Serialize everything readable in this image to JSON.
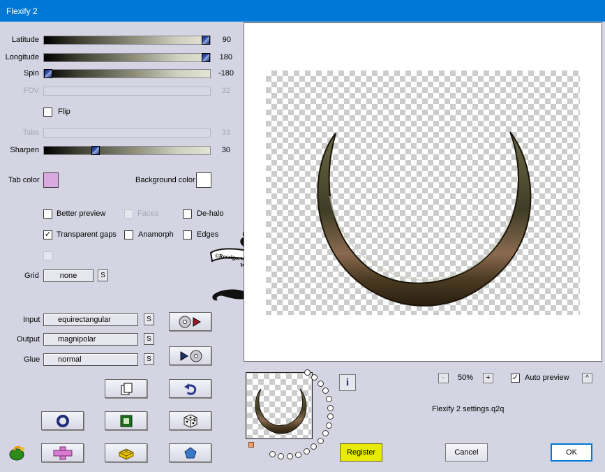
{
  "window": {
    "title": "Flexify 2"
  },
  "sliders": {
    "latitude": {
      "label": "Latitude",
      "value": "90",
      "fraction": 1.0,
      "enabled": true
    },
    "longitude": {
      "label": "Longitude",
      "value": "180",
      "fraction": 1.0,
      "enabled": true
    },
    "spin": {
      "label": "Spin",
      "value": "-180",
      "fraction": 0.0,
      "enabled": true
    },
    "fov": {
      "label": "FOV",
      "value": "32",
      "fraction": 0.2,
      "enabled": false
    },
    "tabs": {
      "label": "Tabs",
      "value": "33",
      "fraction": 0.33,
      "enabled": false
    },
    "sharpen": {
      "label": "Sharpen",
      "value": "30",
      "fraction": 0.3,
      "enabled": true
    }
  },
  "flip": {
    "label": "Flip",
    "checked": false
  },
  "colors": {
    "tab_label": "Tab color",
    "tab_color": "#d9a9df",
    "background_label": "Background color",
    "background_color": "#ffffff"
  },
  "options": {
    "better_preview": {
      "label": "Better preview",
      "checked": false
    },
    "faces": {
      "label": "Faces",
      "checked": false,
      "enabled": false
    },
    "de_halo": {
      "label": "De-halo",
      "checked": false
    },
    "transparent_gaps": {
      "label": "Transparent gaps",
      "checked": true
    },
    "anamorph": {
      "label": "Anamorph",
      "checked": false
    },
    "edges": {
      "label": "Edges",
      "checked": false
    }
  },
  "grid": {
    "label": "Grid",
    "value": "none",
    "s_label": "S"
  },
  "projection": {
    "input_label": "Input",
    "input_value": "equirectangular",
    "output_label": "Output",
    "output_value": "magnipolar",
    "glue_label": "Glue",
    "glue_value": "normal",
    "s_label": "S"
  },
  "preview": {
    "zoom_minus": "-",
    "zoom_value": "50%",
    "zoom_plus": "+",
    "auto_preview_label": "Auto preview",
    "auto_preview_checked": true,
    "collapse_label": "^",
    "settings_file": "Flexify 2 settings.q2q",
    "info_label": "i"
  },
  "watermark": {
    "line1": "©Rosalgarten",
    "line2": "Wien"
  },
  "buttons": {
    "register": "Register",
    "cancel": "Cancel",
    "ok": "OK"
  },
  "icons": {
    "load_preset": "disc-play-icon",
    "save_preset": "play-disc-icon",
    "copy": "copy-pages-icon",
    "undo": "undo-arrow-icon",
    "ring": "ring-icon",
    "square": "green-square-icon",
    "dice": "dice-icon",
    "cross": "pink-cross-icon",
    "brick": "yellow-brick-icon",
    "pentagon": "blue-pentagon-icon",
    "flexify_logo": "flexify-logo-icon"
  }
}
